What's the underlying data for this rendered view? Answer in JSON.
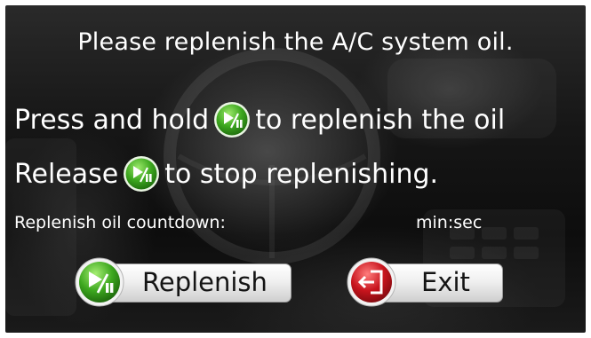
{
  "dialog": {
    "title": "Please replenish the A/C system oil.",
    "line1_before": "Press and hold",
    "line1_after": "to replenish the oil",
    "line2_before": "Release",
    "line2_after": "to stop replenishing.",
    "countdown_label": "Replenish oil countdown:",
    "countdown_value": "min:sec"
  },
  "buttons": {
    "replenish": {
      "label": "Replenish",
      "icon": "play-pause-icon",
      "color": "#3da71f"
    },
    "exit": {
      "label": "Exit",
      "icon": "exit-door-icon",
      "color": "#c8141d"
    }
  },
  "colors": {
    "text": "#ffffff",
    "button_text": "#141414",
    "background": "#111111"
  }
}
